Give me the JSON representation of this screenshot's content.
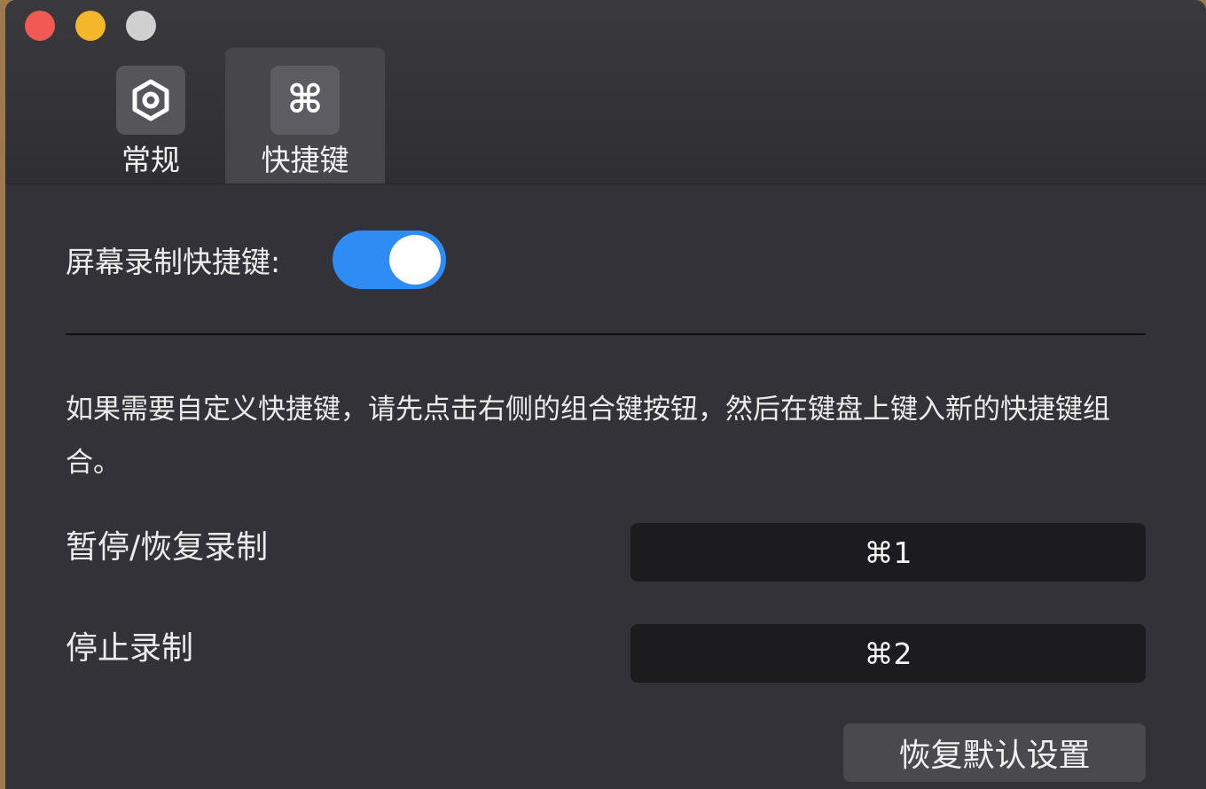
{
  "window": {
    "colors": {
      "close": "#f05a52",
      "minimize": "#f4b62a",
      "zoom": "#d0d0d0",
      "toggle_on": "#2f8cf5"
    }
  },
  "tabs": [
    {
      "label": "常规",
      "icon": "gear-icon",
      "selected": false
    },
    {
      "label": "快捷键",
      "icon": "command-icon",
      "icon_glyph": "⌘",
      "selected": true
    }
  ],
  "screen_record_shortcut": {
    "label": "屏幕录制快捷键:",
    "enabled": true
  },
  "description": "如果需要自定义快捷键，请先点击右侧的组合键按钮，然后在键盘上键入新的快捷键组合。",
  "shortcuts": [
    {
      "label": "暂停/恢复录制",
      "key": "⌘1"
    },
    {
      "label": "停止录制",
      "key": "⌘2"
    }
  ],
  "restore_button_label": "恢复默认设置"
}
